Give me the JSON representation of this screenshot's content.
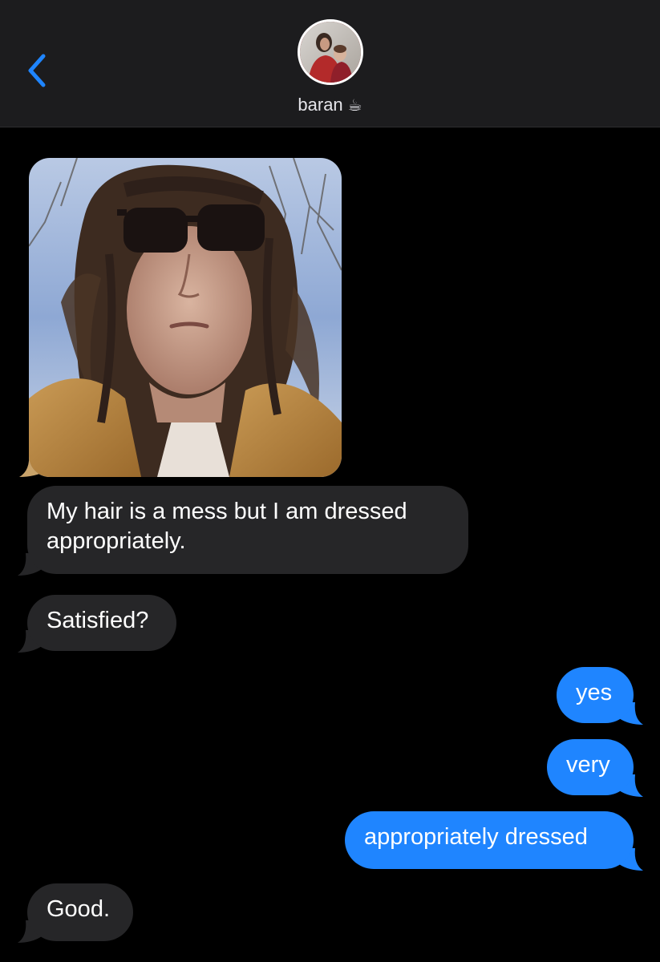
{
  "header": {
    "contact_name": "baran",
    "contact_emoji": "☕",
    "back_icon": "chevron-left-icon",
    "accent_color": "#1f85ff"
  },
  "messages": [
    {
      "direction": "incoming",
      "type": "photo",
      "description": ""
    },
    {
      "direction": "incoming",
      "type": "text",
      "text": "My hair is a mess but I am dressed appropriately."
    },
    {
      "direction": "incoming",
      "type": "text",
      "text": "Satisfied?"
    },
    {
      "direction": "outgoing",
      "type": "text",
      "text": "yes"
    },
    {
      "direction": "outgoing",
      "type": "text",
      "text": "very"
    },
    {
      "direction": "outgoing",
      "type": "text",
      "text": "appropriately dressed"
    },
    {
      "direction": "incoming",
      "type": "text",
      "text": "Good."
    }
  ],
  "colors": {
    "incoming_bubble": "#262628",
    "outgoing_bubble": "#1f85ff",
    "background": "#000000",
    "header_background": "#1c1c1e"
  }
}
